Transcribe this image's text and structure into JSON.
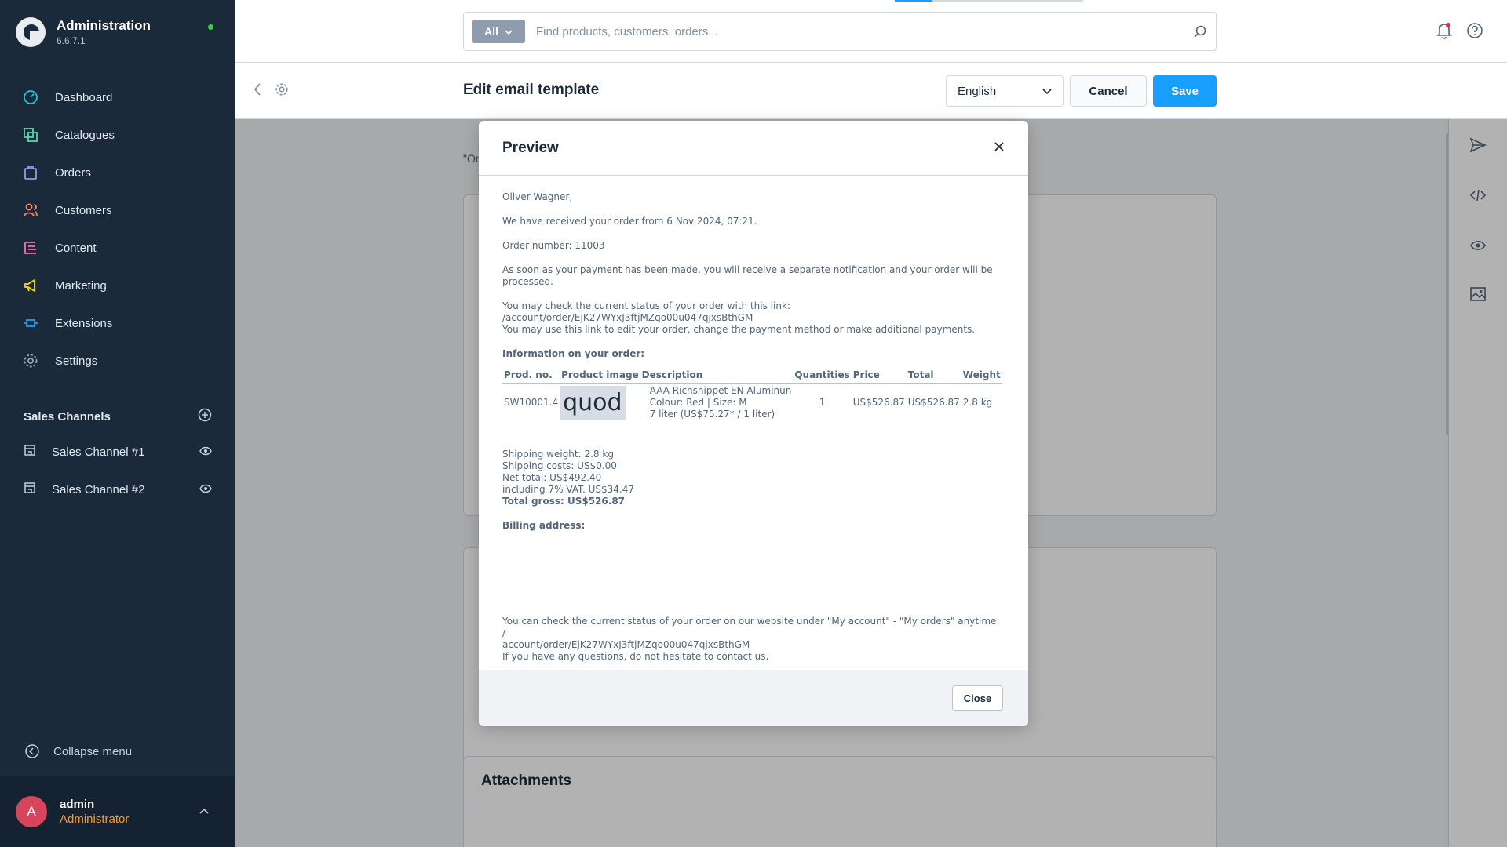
{
  "app": {
    "title": "Administration",
    "version": "6.6.7.1"
  },
  "sidebar": {
    "items": [
      {
        "label": "Dashboard",
        "icon": "dashboard-icon",
        "color": "#29c1d6"
      },
      {
        "label": "Catalogues",
        "icon": "catalogue-icon",
        "color": "#57d9a3"
      },
      {
        "label": "Orders",
        "icon": "orders-icon",
        "color": "#a092f0"
      },
      {
        "label": "Customers",
        "icon": "customers-icon",
        "color": "#f88962"
      },
      {
        "label": "Content",
        "icon": "content-icon",
        "color": "#ff68b4"
      },
      {
        "label": "Marketing",
        "icon": "marketing-icon",
        "color": "#ffd700"
      },
      {
        "label": "Extensions",
        "icon": "extensions-icon",
        "color": "#189eff"
      },
      {
        "label": "Settings",
        "icon": "settings-icon",
        "color": "#9aa8b5"
      }
    ],
    "sales_channels_title": "Sales Channels",
    "sales_channels": [
      {
        "label": "Sales Channel #1"
      },
      {
        "label": "Sales Channel #2"
      }
    ],
    "collapse_label": "Collapse menu",
    "user": {
      "initial": "A",
      "name": "admin",
      "role": "Administrator"
    }
  },
  "search": {
    "type_label": "All",
    "placeholder": "Find products, customers, orders..."
  },
  "page": {
    "title": "Edit email template",
    "language": "English",
    "cancel_label": "Cancel",
    "save_label": "Save",
    "fragment_text": "\"Or",
    "attachments_title": "Attachments"
  },
  "modal": {
    "title": "Preview",
    "greeting": "Oliver Wagner,",
    "received": "We have received your order from 6 Nov 2024, 07:21.",
    "order_number": "Order number: 11003",
    "payment_note": "As soon as your payment has been made, you will receive a separate notification and your order will be processed.",
    "status_link": "You may check the current status of your order with this link: /account/order/EjK27WYxJ3ftjMZqo00u047qjxsBthGM",
    "edit_note": "You may use this link to edit your order, change the payment method or make additional payments.",
    "info_title": "Information on your order:",
    "table": {
      "headers": [
        "Prod. no.",
        "Product image",
        "Description",
        "Quantities",
        "Price",
        "Total",
        "Weight"
      ],
      "row": {
        "prod_no": "SW10001.4",
        "image_text": "quod",
        "desc_line1": "AAA Richsnippet EN Aluminun",
        "desc_line2": "Colour: Red | Size: M",
        "desc_line3": "7 liter (US$75.27* / 1 liter)",
        "quantity": "1",
        "price": "US$526.87",
        "total": "US$526.87",
        "weight": "2.8 kg"
      }
    },
    "shipping_weight": "Shipping weight: 2.8 kg",
    "shipping_costs": "Shipping costs: US$0.00",
    "net_total": "Net total: US$492.40",
    "vat": "including 7% VAT. US$34.47",
    "total_gross": "Total gross: US$526.87",
    "billing_title": "Billing address:",
    "footer_line1": "You can check the current status of your order on our website under \"My account\" - \"My orders\" anytime: /",
    "footer_line2": "account/order/EjK27WYxJ3ftjMZqo00u047qjxsBthGM",
    "footer_line3": "If you have any questions, do not hesitate to contact us.",
    "close_label": "Close"
  },
  "colors": {
    "sidebar_bg": "#1b2a3b",
    "accent": "#189eff",
    "role": "#f39c35",
    "avatar": "#d6455b"
  }
}
